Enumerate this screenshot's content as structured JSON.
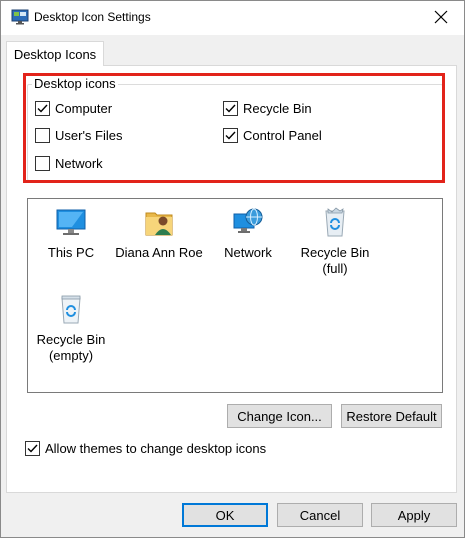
{
  "window": {
    "title": "Desktop Icon Settings",
    "close_label": "×"
  },
  "tab": {
    "label": "Desktop Icons"
  },
  "desktop_icons_group": {
    "legend": "Desktop icons",
    "options": [
      {
        "label": "Computer",
        "checked": true
      },
      {
        "label": "User's Files",
        "checked": false
      },
      {
        "label": "Network",
        "checked": false
      },
      {
        "label": "Recycle Bin",
        "checked": true
      },
      {
        "label": "Control Panel",
        "checked": true
      }
    ]
  },
  "icon_list": [
    {
      "label": "This PC",
      "icon": "monitor-icon"
    },
    {
      "label": "Diana Ann Roe",
      "icon": "user-folder-icon"
    },
    {
      "label": "Network",
      "icon": "network-globe-icon"
    },
    {
      "label": "Recycle Bin\n(full)",
      "icon": "recycle-bin-full-icon"
    },
    {
      "label": "Recycle Bin\n(empty)",
      "icon": "recycle-bin-empty-icon"
    }
  ],
  "buttons": {
    "change_icon": "Change Icon...",
    "restore_default": "Restore Default",
    "ok": "OK",
    "cancel": "Cancel",
    "apply": "Apply"
  },
  "allow_themes": {
    "label": "Allow themes to change desktop icons",
    "checked": true
  },
  "colors": {
    "highlight": "#e2231a",
    "default_button_border": "#0078d7"
  }
}
